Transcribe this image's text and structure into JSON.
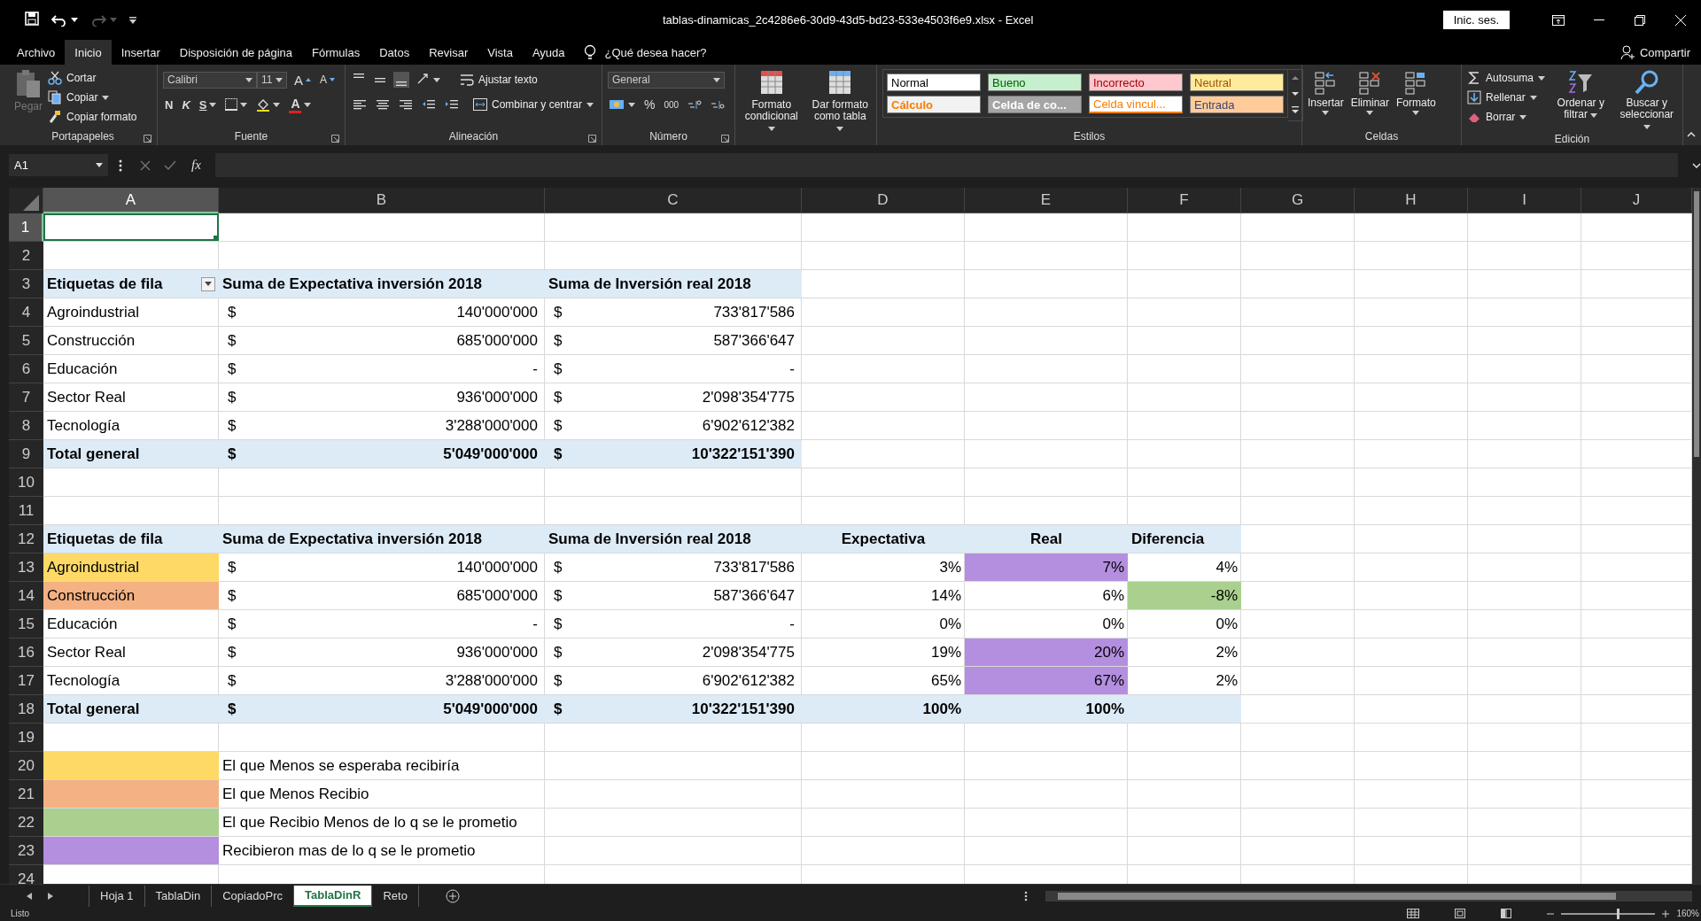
{
  "title_bar": {
    "title": "tablas-dinamicas_2c4286e6-30d9-43d5-bd23-533e4503f6e9.xlsx  -  Excel",
    "sign_in": "Inic. ses.",
    "redo": {
      "disabled": true
    }
  },
  "menu_tabs": [
    {
      "label": "Archivo",
      "selected": false
    },
    {
      "label": "Inicio",
      "selected": true
    },
    {
      "label": "Insertar",
      "selected": false
    },
    {
      "label": "Disposición de página",
      "selected": false
    },
    {
      "label": "Fórmulas",
      "selected": false
    },
    {
      "label": "Datos",
      "selected": false
    },
    {
      "label": "Revisar",
      "selected": false
    },
    {
      "label": "Vista",
      "selected": false
    },
    {
      "label": "Ayuda",
      "selected": false
    }
  ],
  "search": {
    "placeholder": "¿Qué desea hacer?"
  },
  "share": "Compartir",
  "ribbon": {
    "clipboard": {
      "label": "Portapapeles",
      "paste": {
        "label": "Pegar",
        "disabled": true
      },
      "items": [
        {
          "label": "Cortar",
          "dropdown": false
        },
        {
          "label": "Copiar",
          "dropdown": true
        },
        {
          "label": "Copiar formato",
          "dropdown": false
        }
      ]
    },
    "font": {
      "label": "Fuente",
      "family": "Calibri",
      "size": "11",
      "grow": "A",
      "shrink": "A",
      "bold": "N",
      "italic": "K",
      "underline": "S",
      "color_letter": "A"
    },
    "alignment": {
      "label": "Alineación",
      "wrap": "Ajustar texto",
      "merge": "Combinar y centrar",
      "vertical_align": [
        {
          "selected": false
        },
        {
          "selected": false
        },
        {
          "selected": true
        }
      ]
    },
    "number": {
      "label": "Número",
      "format": "General",
      "percent": "%",
      "thousands": "000"
    },
    "table_tools": [
      {
        "label": "Formato condicional"
      },
      {
        "label": "Dar formato como tabla"
      }
    ],
    "styles": {
      "label": "Estilos",
      "items": [
        {
          "label": "Normal",
          "color": "#ffffff",
          "kind": "normal"
        },
        {
          "label": "Bueno",
          "color": "#c6efce",
          "kind": "good"
        },
        {
          "label": "Incorrecto",
          "color": "#ffc7ce",
          "kind": "bad"
        },
        {
          "label": "Neutral",
          "color": "#ffeb9c",
          "kind": "neutral"
        },
        {
          "label": "Cálculo",
          "color": "#f2f2f2",
          "kind": "calculation"
        },
        {
          "label": "Celda de co...",
          "color": "#a5a5a5",
          "kind": "check"
        },
        {
          "label": "Celda vincul...",
          "color": "#ffffff",
          "kind": "linked"
        },
        {
          "label": "Entrada",
          "color": "#ffcc99",
          "kind": "input"
        }
      ]
    },
    "cells": {
      "label": "Celdas",
      "items": [
        {
          "label": "Insertar"
        },
        {
          "label": "Eliminar"
        },
        {
          "label": "Formato"
        }
      ]
    },
    "editing": {
      "label": "Edición",
      "small": [
        {
          "label": "Autosuma"
        },
        {
          "label": "Rellenar"
        },
        {
          "label": "Borrar"
        }
      ],
      "big": [
        {
          "label": "Ordenar y filtrar"
        },
        {
          "label": "Buscar y seleccionar"
        }
      ]
    }
  },
  "formula_bar": {
    "name_box": "A1",
    "fx": "fx"
  },
  "sheet": {
    "columns": [
      {
        "label": "A",
        "selected": true
      },
      {
        "label": "B",
        "selected": false
      },
      {
        "label": "C",
        "selected": false
      },
      {
        "label": "D",
        "selected": false
      },
      {
        "label": "E",
        "selected": false
      },
      {
        "label": "F",
        "selected": false
      },
      {
        "label": "G",
        "selected": false
      },
      {
        "label": "H",
        "selected": false
      },
      {
        "label": "I",
        "selected": false
      },
      {
        "label": "J",
        "selected": false
      }
    ],
    "rows": [
      {
        "label": "1",
        "selected": true,
        "cells": [
          {
            "selected": true
          }
        ]
      },
      {
        "label": "2",
        "selected": false,
        "cells": []
      },
      {
        "label": "3",
        "selected": false,
        "bold": true,
        "cells": [
          {
            "text": "Etiquetas de fila",
            "color": "#ddebf7",
            "filter_button": true
          },
          {
            "text": "Suma de Expectativa inversión 2018",
            "color": "#ddebf7"
          },
          {
            "text": "Suma de Inversión real 2018",
            "color": "#ddebf7"
          }
        ]
      },
      {
        "label": "4",
        "selected": false,
        "bold": false,
        "cells": [
          {
            "text": "Agroindustrial"
          },
          {
            "prefix": "$",
            "text": "140'000'000"
          },
          {
            "prefix": "$",
            "text": "733'817'586"
          }
        ]
      },
      {
        "label": "5",
        "selected": false,
        "bold": false,
        "cells": [
          {
            "text": "Construcción"
          },
          {
            "prefix": "$",
            "text": "685'000'000"
          },
          {
            "prefix": "$",
            "text": "587'366'647"
          }
        ]
      },
      {
        "label": "6",
        "selected": false,
        "bold": false,
        "cells": [
          {
            "text": "Educación"
          },
          {
            "prefix": "$",
            "text": "-"
          },
          {
            "prefix": "$",
            "text": "-"
          }
        ]
      },
      {
        "label": "7",
        "selected": false,
        "bold": false,
        "cells": [
          {
            "text": "Sector Real"
          },
          {
            "prefix": "$",
            "text": "936'000'000"
          },
          {
            "prefix": "$",
            "text": "2'098'354'775"
          }
        ]
      },
      {
        "label": "8",
        "selected": false,
        "bold": false,
        "cells": [
          {
            "text": "Tecnología"
          },
          {
            "prefix": "$",
            "text": "3'288'000'000"
          },
          {
            "prefix": "$",
            "text": "6'902'612'382"
          }
        ]
      },
      {
        "label": "9",
        "selected": false,
        "bold": true,
        "cells": [
          {
            "text": "Total general",
            "color": "#ddebf7"
          },
          {
            "prefix": "$",
            "text": "5'049'000'000",
            "color": "#ddebf7"
          },
          {
            "prefix": "$",
            "text": "10'322'151'390",
            "color": "#ddebf7"
          }
        ]
      },
      {
        "label": "10",
        "selected": false,
        "cells": []
      },
      {
        "label": "11",
        "selected": false,
        "cells": []
      },
      {
        "label": "12",
        "selected": false,
        "bold": true,
        "cells": [
          {
            "text": "Etiquetas de fila",
            "color": "#ddebf7"
          },
          {
            "text": "Suma de Expectativa inversión 2018",
            "color": "#ddebf7"
          },
          {
            "text": "Suma de Inversión real 2018",
            "color": "#ddebf7"
          },
          {
            "text": "Expectativa",
            "color": "#ddebf7",
            "kind": "centered"
          },
          {
            "text": "Real",
            "color": "#ddebf7",
            "kind": "centered"
          },
          {
            "text": "Diferencia",
            "color": "#ddebf7"
          }
        ]
      },
      {
        "label": "13",
        "selected": false,
        "bold": false,
        "cells": [
          {
            "text": "Agroindustrial",
            "color": "#ffd966"
          },
          {
            "prefix": "$",
            "text": "140'000'000"
          },
          {
            "prefix": "$",
            "text": "733'817'586"
          },
          {
            "text": "3%",
            "kind": "number"
          },
          {
            "text": "7%",
            "kind": "number",
            "color": "#b48fe0"
          },
          {
            "text": "4%",
            "kind": "number"
          }
        ]
      },
      {
        "label": "14",
        "selected": false,
        "bold": false,
        "cells": [
          {
            "text": "Construcción",
            "color": "#f4b183"
          },
          {
            "prefix": "$",
            "text": "685'000'000"
          },
          {
            "prefix": "$",
            "text": "587'366'647"
          },
          {
            "text": "14%",
            "kind": "number"
          },
          {
            "text": "6%",
            "kind": "number"
          },
          {
            "text": "-8%",
            "kind": "number",
            "color": "#a9d08e"
          }
        ]
      },
      {
        "label": "15",
        "selected": false,
        "bold": false,
        "cells": [
          {
            "text": "Educación"
          },
          {
            "prefix": "$",
            "text": "-"
          },
          {
            "prefix": "$",
            "text": "-"
          },
          {
            "text": "0%",
            "kind": "number"
          },
          {
            "text": "0%",
            "kind": "number"
          },
          {
            "text": "0%",
            "kind": "number"
          }
        ]
      },
      {
        "label": "16",
        "selected": false,
        "bold": false,
        "cells": [
          {
            "text": "Sector Real"
          },
          {
            "prefix": "$",
            "text": "936'000'000"
          },
          {
            "prefix": "$",
            "text": "2'098'354'775"
          },
          {
            "text": "19%",
            "kind": "number"
          },
          {
            "text": "20%",
            "kind": "number",
            "color": "#b48fe0"
          },
          {
            "text": "2%",
            "kind": "number"
          }
        ]
      },
      {
        "label": "17",
        "selected": false,
        "bold": false,
        "cells": [
          {
            "text": "Tecnología"
          },
          {
            "prefix": "$",
            "text": "3'288'000'000"
          },
          {
            "prefix": "$",
            "text": "6'902'612'382"
          },
          {
            "text": "65%",
            "kind": "number"
          },
          {
            "text": "67%",
            "kind": "number",
            "color": "#b48fe0"
          },
          {
            "text": "2%",
            "kind": "number"
          }
        ]
      },
      {
        "label": "18",
        "selected": false,
        "bold": true,
        "cells": [
          {
            "text": "Total general",
            "color": "#ddebf7"
          },
          {
            "prefix": "$",
            "text": "5'049'000'000",
            "color": "#ddebf7"
          },
          {
            "prefix": "$",
            "text": "10'322'151'390",
            "color": "#ddebf7"
          },
          {
            "text": "100%",
            "kind": "number",
            "color": "#ddebf7"
          },
          {
            "text": "100%",
            "kind": "number",
            "color": "#ddebf7"
          },
          {
            "color": "#ddebf7"
          }
        ]
      },
      {
        "label": "19",
        "selected": false,
        "cells": []
      },
      {
        "label": "20",
        "selected": false,
        "bold": false,
        "cells": [
          {
            "color": "#ffd966"
          },
          {
            "text": "El que Menos se esperaba recibiría"
          }
        ]
      },
      {
        "label": "21",
        "selected": false,
        "bold": false,
        "cells": [
          {
            "color": "#f4b183"
          },
          {
            "text": "El que Menos Recibio"
          }
        ]
      },
      {
        "label": "22",
        "selected": false,
        "bold": false,
        "cells": [
          {
            "color": "#a9d08e"
          },
          {
            "text": "El que Recibio Menos de lo q se le prometio"
          }
        ]
      },
      {
        "label": "23",
        "selected": false,
        "bold": false,
        "cells": [
          {
            "color": "#b48fe0"
          },
          {
            "text": "Recibieron mas de lo q se le prometio"
          }
        ]
      },
      {
        "label": "24",
        "selected": false,
        "cells": []
      }
    ]
  },
  "sheet_tabs": [
    {
      "label": "Hoja 1",
      "selected": false
    },
    {
      "label": "TablaDin",
      "selected": false
    },
    {
      "label": "CopiadoPrc",
      "selected": false
    },
    {
      "label": "TablaDinR",
      "selected": true
    },
    {
      "label": "Reto",
      "selected": false
    }
  ],
  "status_bar": {
    "status": "Listo",
    "zoom": {
      "level": 0.59,
      "reading": "160%"
    }
  }
}
